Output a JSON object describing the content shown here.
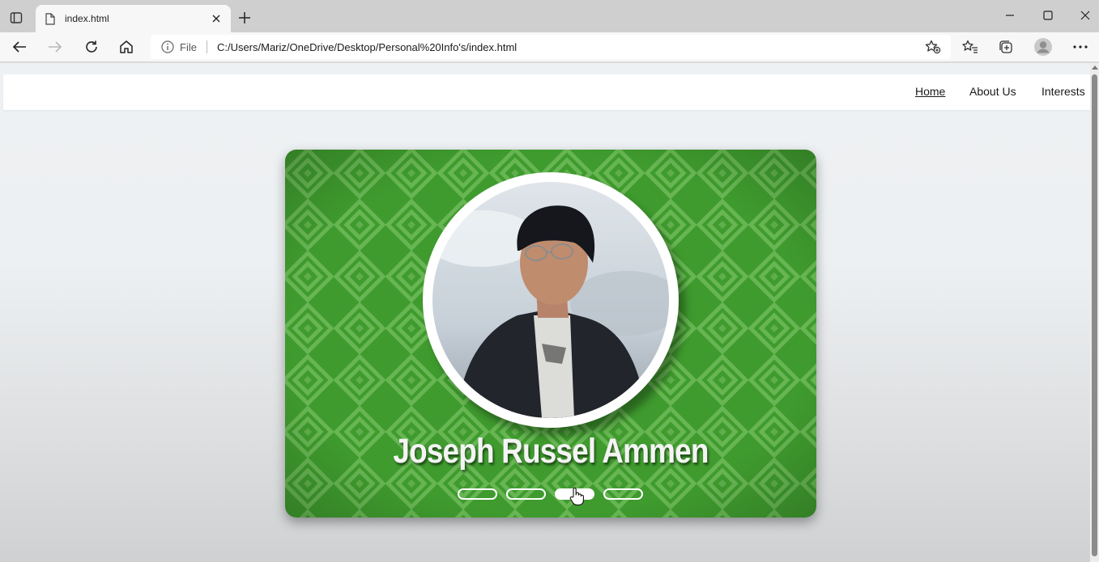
{
  "browser": {
    "tab": {
      "title": "index.html"
    },
    "address": {
      "file_label": "File",
      "url": "C:/Users/Mariz/OneDrive/Desktop/Personal%20Info's/index.html"
    }
  },
  "page": {
    "nav": {
      "items": [
        {
          "label": "Home",
          "active": true
        },
        {
          "label": "About Us",
          "active": false
        },
        {
          "label": "Interests",
          "active": false
        }
      ]
    },
    "hero": {
      "name": "Joseph Russel Ammen",
      "slides": {
        "count": 4,
        "active_index": 2
      }
    }
  },
  "colors": {
    "card_green": "#3f9b2e",
    "pattern_light": "#66b552",
    "avatar_ring": "#ffffff"
  }
}
